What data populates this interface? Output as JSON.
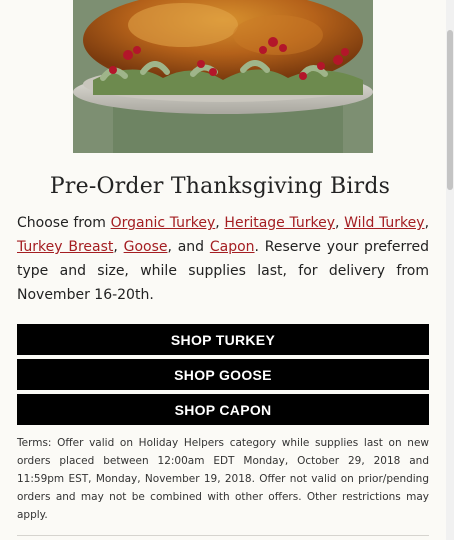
{
  "hero": {
    "image_alt": "roasted turkey on platter with herbs and cranberries"
  },
  "heading": "Pre-Order Thanksgiving Birds",
  "description": {
    "prefix": "Choose from ",
    "links": [
      "Organic Turkey",
      "Heritage Turkey",
      "Wild Turkey",
      "Turkey Breast",
      "Goose",
      "Capon"
    ],
    "sep1": ", ",
    "sep2": ", ",
    "sep3": ", ",
    "sep4": ", ",
    "sep5": ", and ",
    "suffix": ". Reserve your preferred type and size, while supplies last, for delivery from November 16-20th."
  },
  "buttons": [
    "SHOP TURKEY",
    "SHOP GOOSE",
    "SHOP CAPON"
  ],
  "terms": "Terms: Offer valid on Holiday Helpers category while supplies last on new orders placed between 12:00am EDT Monday, October 29, 2018 and 11:59pm EST, Monday, November 19, 2018. Offer not valid on prior/pending orders and may not be combined with other offers. Other restrictions may apply.",
  "colors": {
    "link": "#a41e22",
    "button_bg": "#000000",
    "button_text": "#ffffff",
    "page_bg": "#fbfaf6"
  }
}
